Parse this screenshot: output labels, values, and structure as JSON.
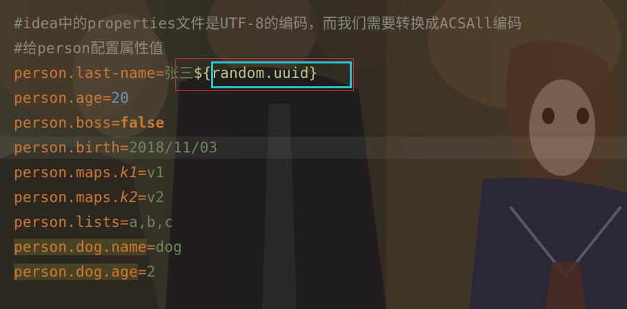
{
  "editor": {
    "comment_line_1": "#idea中的properties文件是UTF-8的编码，而我们需要转换成ACSAll编码",
    "comment_line_2": "#给person配置属性值",
    "lines": [
      {
        "key": "person.last-name",
        "value_prefix": "张三",
        "value_expr": "${random.uuid}"
      },
      {
        "key": "person.age",
        "value": "20"
      },
      {
        "key": "person.boss",
        "value": "false"
      },
      {
        "key": "person.birth",
        "value": "2018/11/03"
      },
      {
        "key_prefix": "person.maps.",
        "key_suffix": "k1",
        "value": "v1"
      },
      {
        "key_prefix": "person.maps.",
        "key_suffix": "k2",
        "value": "v2"
      },
      {
        "key": "person.lists",
        "value": "a,b,c"
      },
      {
        "key": "person.dog.name",
        "value": "dog"
      },
      {
        "key": "person.dog.age",
        "value": "2"
      }
    ],
    "equals": "=",
    "colors": {
      "key": "#cc7832",
      "string_value": "#6a8759",
      "number_value": "#6897bb",
      "comment": "#8a8a80",
      "highlight_red": "#d32f2f",
      "highlight_cyan": "#28c4d4"
    }
  }
}
